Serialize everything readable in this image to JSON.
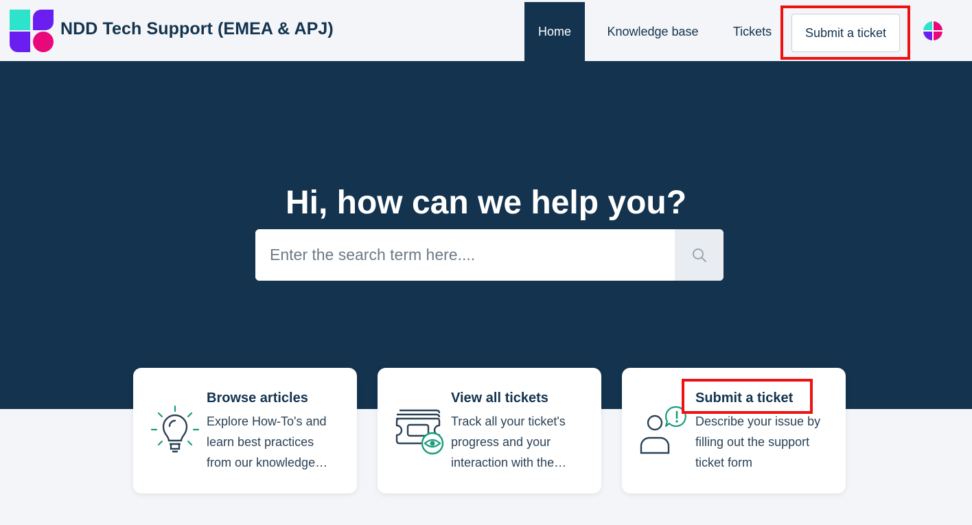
{
  "brand": {
    "title": "NDD Tech Support (EMEA & APJ)"
  },
  "nav": {
    "home": "Home",
    "knowledge_base": "Knowledge base",
    "tickets": "Tickets",
    "submit_ticket": "Submit a ticket"
  },
  "hero": {
    "title": "Hi, how can we help you?",
    "search_placeholder": "Enter the search term here...."
  },
  "cards": [
    {
      "title": "Browse articles",
      "description": "Explore How-To's and learn best practices from our knowledge base",
      "icon": "lightbulb-icon"
    },
    {
      "title": "View all tickets",
      "description": "Track all your ticket's progress and your interaction with the support team",
      "icon": "tickets-view-icon"
    },
    {
      "title": "Submit a ticket",
      "description": "Describe your issue by filling out the support ticket form",
      "icon": "user-alert-icon"
    }
  ],
  "colors": {
    "navy": "#13334e",
    "accent_green": "#1a9b7b",
    "highlight_red": "#ee1111",
    "logo_teal": "#2de3cc",
    "logo_purple": "#6a1ef0",
    "logo_pink": "#e8087a"
  }
}
